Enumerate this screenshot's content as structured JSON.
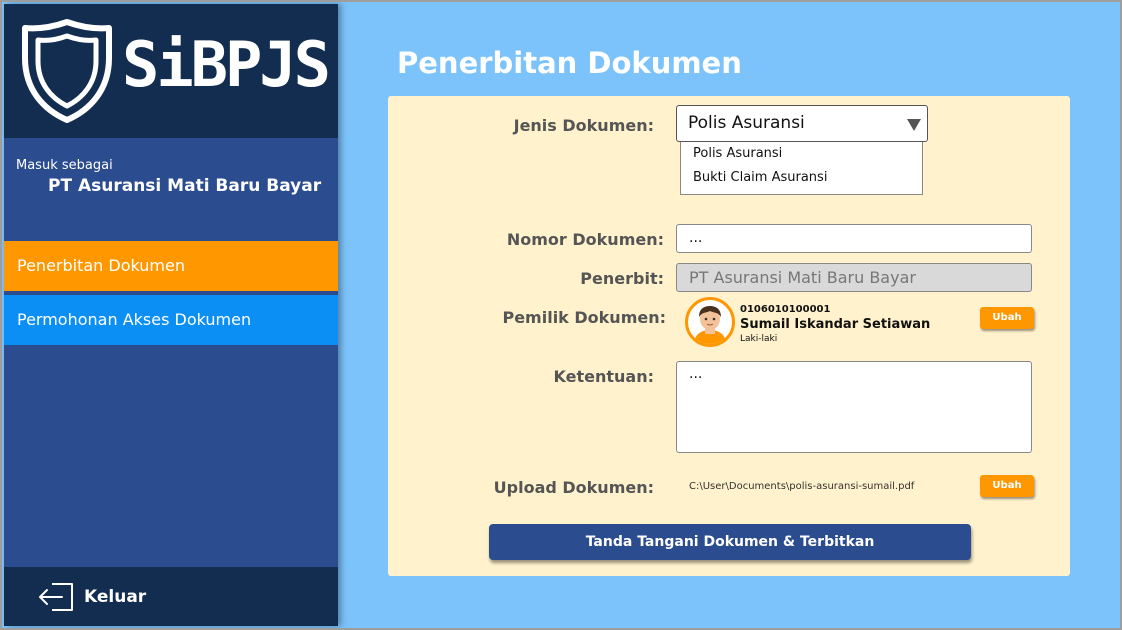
{
  "app": {
    "logo_text": "SiBPJS"
  },
  "sidebar": {
    "login_as_label": "Masuk sebagai",
    "company": "PT Asuransi Mati Baru Bayar",
    "items": [
      {
        "label": "Penerbitan Dokumen",
        "active": true
      },
      {
        "label": "Permohonan Akses Dokumen",
        "active": false
      }
    ],
    "logout_label": "Keluar"
  },
  "main": {
    "title": "Penerbitan Dokumen",
    "form": {
      "doc_type_label": "Jenis Dokumen:",
      "doc_type_value": "Polis Asuransi",
      "doc_type_options": [
        "Polis Asuransi",
        "Bukti Claim Asuransi"
      ],
      "doc_number_label": "Nomor Dokumen:",
      "doc_number_value": "...",
      "issuer_label": "Penerbit:",
      "issuer_value": "PT Asuransi Mati Baru Bayar",
      "owner_label": "Pemilik Dokumen:",
      "owner": {
        "id": "0106010100001",
        "name": "Sumail Iskandar Setiawan",
        "gender": "Laki-laki"
      },
      "change_label": "Ubah",
      "terms_label": "Ketentuan:",
      "terms_value": "...",
      "upload_label": "Upload Dokumen:",
      "upload_path": "C:\\User\\Documents\\polis-asuransi-sumail.pdf",
      "submit_label": "Tanda Tangani Dokumen & Terbitkan"
    }
  },
  "colors": {
    "background": "#7cc3fb",
    "sidebar": "#2b4c8f",
    "sidebar_dark": "#132d51",
    "active_nav": "#ff9800",
    "secondary_nav": "#0c8ff5",
    "card": "#fff2cc",
    "accent": "#ff9800"
  }
}
